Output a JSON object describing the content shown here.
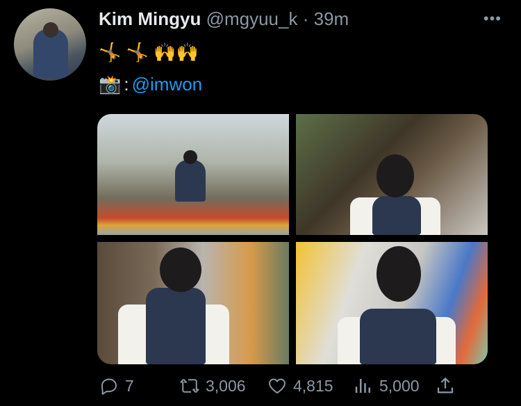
{
  "tweet": {
    "author_name": "Kim Mingyu",
    "handle": "@mgyuu_k",
    "separator": "·",
    "time": "39m",
    "more_label": "•••",
    "emoji_line": "🤸 🤸 🙌🙌",
    "camera_emoji": "📸",
    "colon": ":",
    "mention": "@imwon"
  },
  "actions": {
    "replies": "7",
    "retweets": "3,006",
    "likes": "4,815",
    "views": "5,000"
  },
  "colors": {
    "accent": "#1d9bf0",
    "muted": "#8b98a5",
    "background": "#000000"
  }
}
